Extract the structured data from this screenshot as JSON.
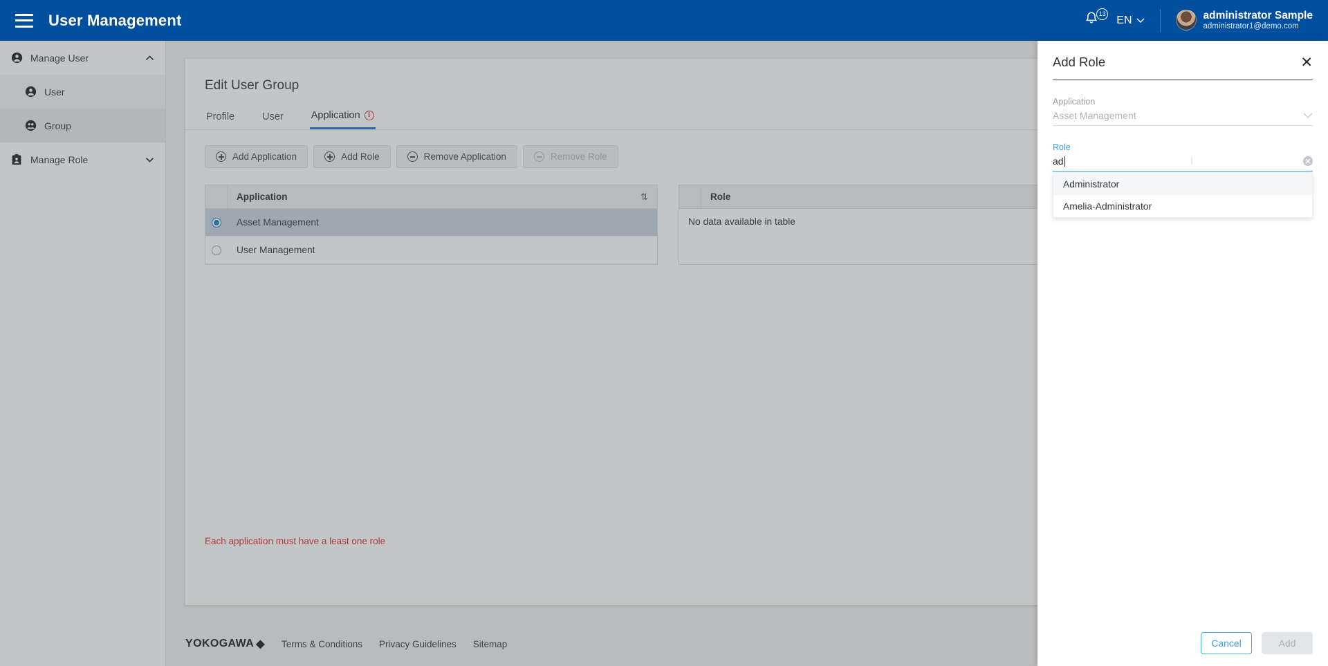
{
  "topbar": {
    "menu_icon": "hamburger-icon",
    "title": "User Management",
    "bell_icon": "bell-icon",
    "notification_count": "13",
    "language": "EN",
    "chevron": "⌄",
    "user_name": "administrator Sample",
    "user_email": "administrator1@demo.com"
  },
  "sidebar": {
    "items": [
      {
        "label": "Manage User",
        "icon": "user-circle-icon",
        "chevron": "⌃",
        "expanded": true
      },
      {
        "label": "User",
        "icon": "user-circle-icon"
      },
      {
        "label": "Group",
        "icon": "group-icon"
      },
      {
        "label": "Manage Role",
        "icon": "role-badge-icon",
        "chevron": "⌄",
        "expanded": false
      }
    ]
  },
  "main": {
    "page_title": "Edit User Group",
    "tabs": [
      {
        "label": "Profile",
        "active": false
      },
      {
        "label": "User",
        "active": false
      },
      {
        "label": "Application",
        "active": true,
        "warning": "i"
      }
    ],
    "buttons": [
      {
        "label": "Add Application",
        "icon": "plus-circle-icon",
        "disabled": false
      },
      {
        "label": "Add Role",
        "icon": "plus-circle-icon",
        "disabled": false
      },
      {
        "label": "Remove Application",
        "icon": "minus-circle-icon",
        "disabled": false
      },
      {
        "label": "Remove Role",
        "icon": "minus-circle-icon",
        "disabled": true
      }
    ],
    "application_table": {
      "header": "Application",
      "sort_icon": "⇅",
      "rows": [
        {
          "label": "Asset Management",
          "selected": true
        },
        {
          "label": "User Management",
          "selected": false
        }
      ]
    },
    "role_table": {
      "header": "Role",
      "empty_text": "No data available in table",
      "rows": []
    },
    "error_message": "Each application must have a least one role"
  },
  "footer": {
    "brand": "YOKOGAWA",
    "brand_mark": "◆",
    "links": [
      "Terms & Conditions",
      "Privacy Guidelines",
      "Sitemap"
    ]
  },
  "panel": {
    "title": "Add Role",
    "close_icon": "✕",
    "application_field": {
      "label": "Application",
      "value": "Asset Management",
      "chevron": "⌄",
      "disabled": true
    },
    "role_field": {
      "label": "Role",
      "value": "ad",
      "placeholder": "",
      "clear_icon": "✕",
      "focused": true
    },
    "dropdown_options": [
      {
        "label": "Administrator",
        "highlighted": true
      },
      {
        "label": "Amelia-Administrator",
        "highlighted": false
      }
    ],
    "cancel_label": "Cancel",
    "add_label": "Add"
  },
  "colors": {
    "brand_blue": "#004f9e",
    "accent_blue": "#1976d2",
    "link_blue": "#3f9ee0",
    "error_red": "#d32f2f",
    "selected_row": "#c6d4e2"
  }
}
